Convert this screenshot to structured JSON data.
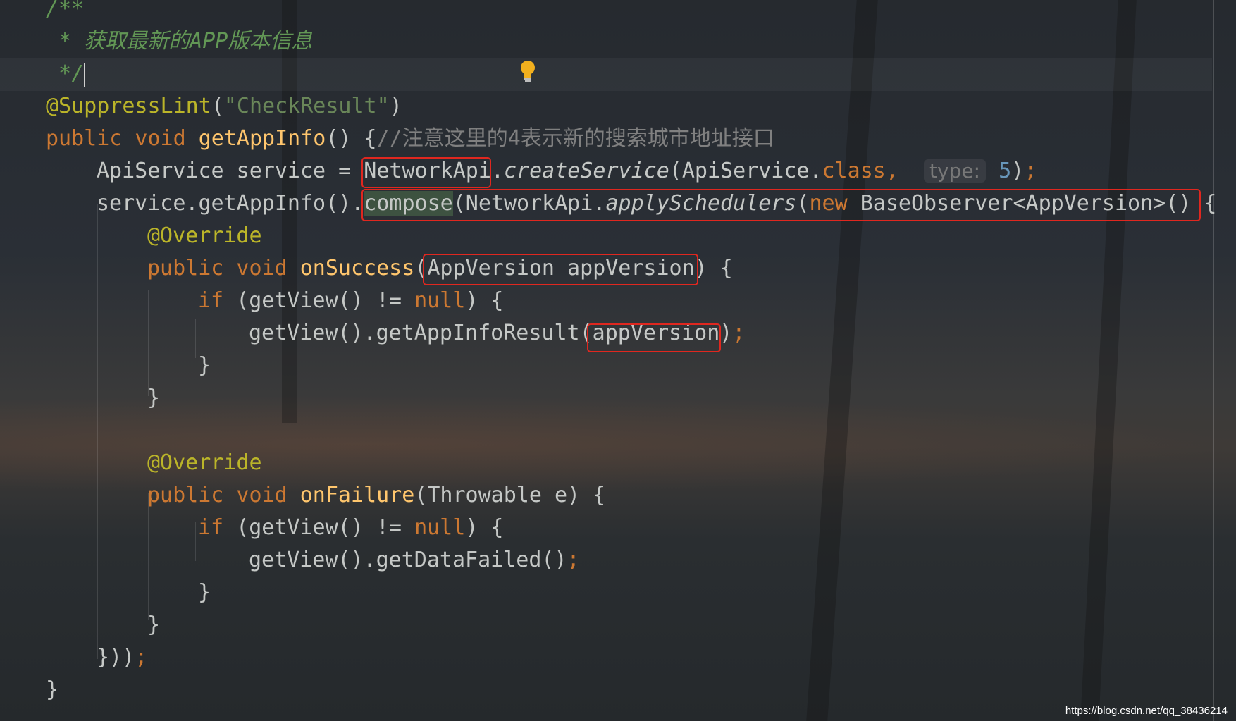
{
  "editor": {
    "lines": [
      {
        "indent": 65,
        "tokens": [
          {
            "c": "cm",
            "t": "/**"
          }
        ]
      },
      {
        "indent": 65,
        "tokens": [
          {
            "c": "cm",
            "t": " * 获取最新的APP版本信息"
          }
        ]
      },
      {
        "indent": 65,
        "caret": true,
        "tokens": [
          {
            "c": "cm",
            "t": " */"
          }
        ]
      },
      {
        "indent": 65,
        "tokens": [
          {
            "c": "an",
            "t": "@SuppressLint"
          },
          {
            "c": "",
            "t": "("
          },
          {
            "c": "st",
            "t": "\"CheckResult\""
          },
          {
            "c": "",
            "t": ")"
          }
        ]
      },
      {
        "indent": 65,
        "tokens": [
          {
            "c": "kw",
            "t": "public void "
          },
          {
            "c": "fn",
            "t": "getAppInfo"
          },
          {
            "c": "",
            "t": "() {"
          },
          {
            "c": "gr",
            "t": "//注意这里的4表示新的搜索城市地址接口"
          }
        ]
      },
      {
        "indent": 137,
        "tokens": [
          {
            "c": "",
            "t": "ApiService service = NetworkApi."
          },
          {
            "c": "it",
            "t": "createService"
          },
          {
            "c": "",
            "t": "(ApiService."
          },
          {
            "c": "kw",
            "t": "class"
          },
          {
            "c": "kw",
            "t": ",  "
          },
          {
            "c": "hint",
            "t": "type:"
          },
          {
            "c": "num",
            "t": " 5"
          },
          {
            "c": "",
            "t": ")"
          },
          {
            "c": "kw",
            "t": ";"
          }
        ]
      },
      {
        "indent": 137,
        "tokens": [
          {
            "c": "",
            "t": "service.getAppInfo()."
          },
          {
            "c": "hl",
            "t": "compose"
          },
          {
            "c": "",
            "t": "(NetworkApi."
          },
          {
            "c": "it",
            "t": "applySchedulers"
          },
          {
            "c": "",
            "t": "("
          },
          {
            "c": "kw",
            "t": "new "
          },
          {
            "c": "",
            "t": "BaseObserver<AppVersion>() {"
          }
        ]
      },
      {
        "indent": 209,
        "tokens": [
          {
            "c": "an",
            "t": "@Override"
          }
        ]
      },
      {
        "indent": 209,
        "tokens": [
          {
            "c": "kw",
            "t": "public void "
          },
          {
            "c": "fn",
            "t": "onSuccess"
          },
          {
            "c": "",
            "t": "(AppVersion appVersion) {"
          }
        ]
      },
      {
        "indent": 281,
        "tokens": [
          {
            "c": "kw",
            "t": "if "
          },
          {
            "c": "",
            "t": "(getView() != "
          },
          {
            "c": "kw",
            "t": "null"
          },
          {
            "c": "",
            "t": ") {"
          }
        ]
      },
      {
        "indent": 353,
        "tokens": [
          {
            "c": "",
            "t": "getView().getAppInfoResult(appVersion)"
          },
          {
            "c": "kw",
            "t": ";"
          }
        ]
      },
      {
        "indent": 281,
        "tokens": [
          {
            "c": "",
            "t": "}"
          }
        ]
      },
      {
        "indent": 209,
        "tokens": [
          {
            "c": "",
            "t": "}"
          }
        ]
      },
      {
        "indent": 209,
        "tokens": []
      },
      {
        "indent": 209,
        "tokens": [
          {
            "c": "an",
            "t": "@Override"
          }
        ]
      },
      {
        "indent": 209,
        "tokens": [
          {
            "c": "kw",
            "t": "public void "
          },
          {
            "c": "fn",
            "t": "onFailure"
          },
          {
            "c": "",
            "t": "(Throwable e) {"
          }
        ]
      },
      {
        "indent": 281,
        "tokens": [
          {
            "c": "kw",
            "t": "if "
          },
          {
            "c": "",
            "t": "(getView() != "
          },
          {
            "c": "kw",
            "t": "null"
          },
          {
            "c": "",
            "t": ") {"
          }
        ]
      },
      {
        "indent": 353,
        "tokens": [
          {
            "c": "",
            "t": "getView().getDataFailed()"
          },
          {
            "c": "kw",
            "t": ";"
          }
        ]
      },
      {
        "indent": 281,
        "tokens": [
          {
            "c": "",
            "t": "}"
          }
        ]
      },
      {
        "indent": 209,
        "tokens": [
          {
            "c": "",
            "t": "}"
          }
        ]
      },
      {
        "indent": 137,
        "tokens": [
          {
            "c": "",
            "t": "}))"
          },
          {
            "c": "kw",
            "t": ";"
          }
        ]
      },
      {
        "indent": 65,
        "tokens": [
          {
            "c": "",
            "t": "}"
          }
        ]
      }
    ]
  },
  "colors": {
    "comment": "#629755",
    "keyword": "#cc7832",
    "method": "#ffc66d",
    "annotation": "#bbb529",
    "string": "#6a8759",
    "number": "#6897bb",
    "highlight_box": "#e0271f"
  },
  "icons": {
    "intention": "lightbulb-icon"
  },
  "watermark": "https://blog.csdn.net/qq_38436214"
}
